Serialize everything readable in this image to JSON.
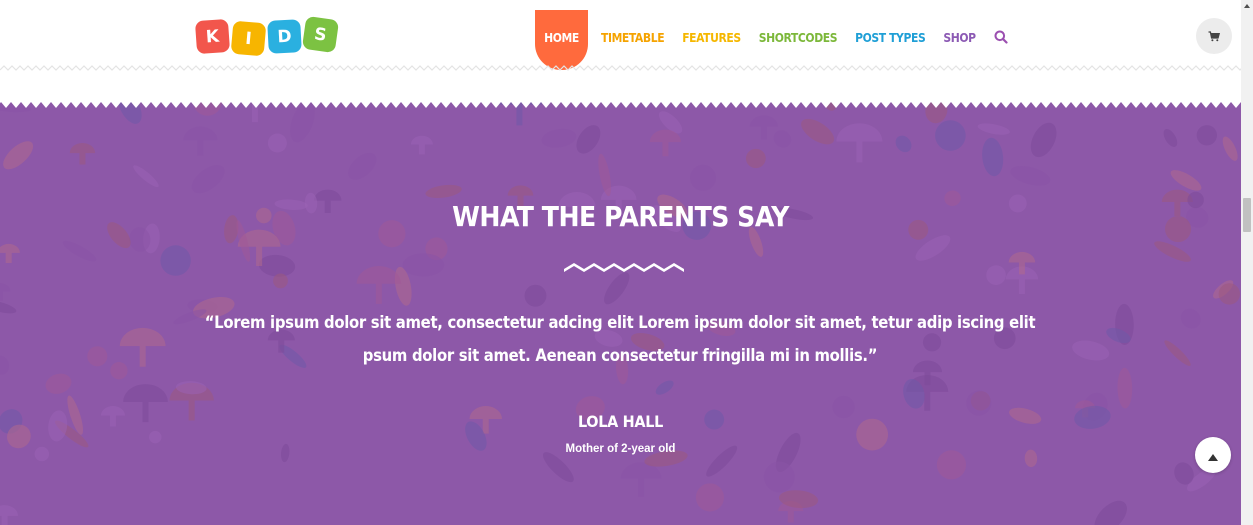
{
  "logo": {
    "letters": [
      "K",
      "I",
      "D",
      "S"
    ]
  },
  "nav": {
    "items": [
      {
        "label": "HOME",
        "color": "#ffffff",
        "active": true
      },
      {
        "label": "TIMETABLE",
        "color": "#f5a300"
      },
      {
        "label": "FEATURES",
        "color": "#f5b700"
      },
      {
        "label": "SHORTCODES",
        "color": "#7cb83a"
      },
      {
        "label": "POST TYPES",
        "color": "#1f9fd6"
      },
      {
        "label": "SHOP",
        "color": "#8c5ab4"
      }
    ],
    "search_icon": "search-icon",
    "active_color": "#ff6a3d"
  },
  "header": {
    "cart_icon": "shopping-cart-icon"
  },
  "testimonial": {
    "title": "WHAT THE PARENTS SAY",
    "quote_line1": "“Lorem ipsum dolor sit amet, consectetur adcing elit Lorem ipsum dolor sit amet, tetur adip iscing elit",
    "quote_line2": "psum dolor sit  amet. Aenean consectetur fringilla mi in mollis.”",
    "author_name": "LOLA HALL",
    "author_role": "Mother of 2-year old",
    "background_color": "#8d58a8"
  },
  "back_to_top": {
    "icon": "arrow-up-icon"
  }
}
